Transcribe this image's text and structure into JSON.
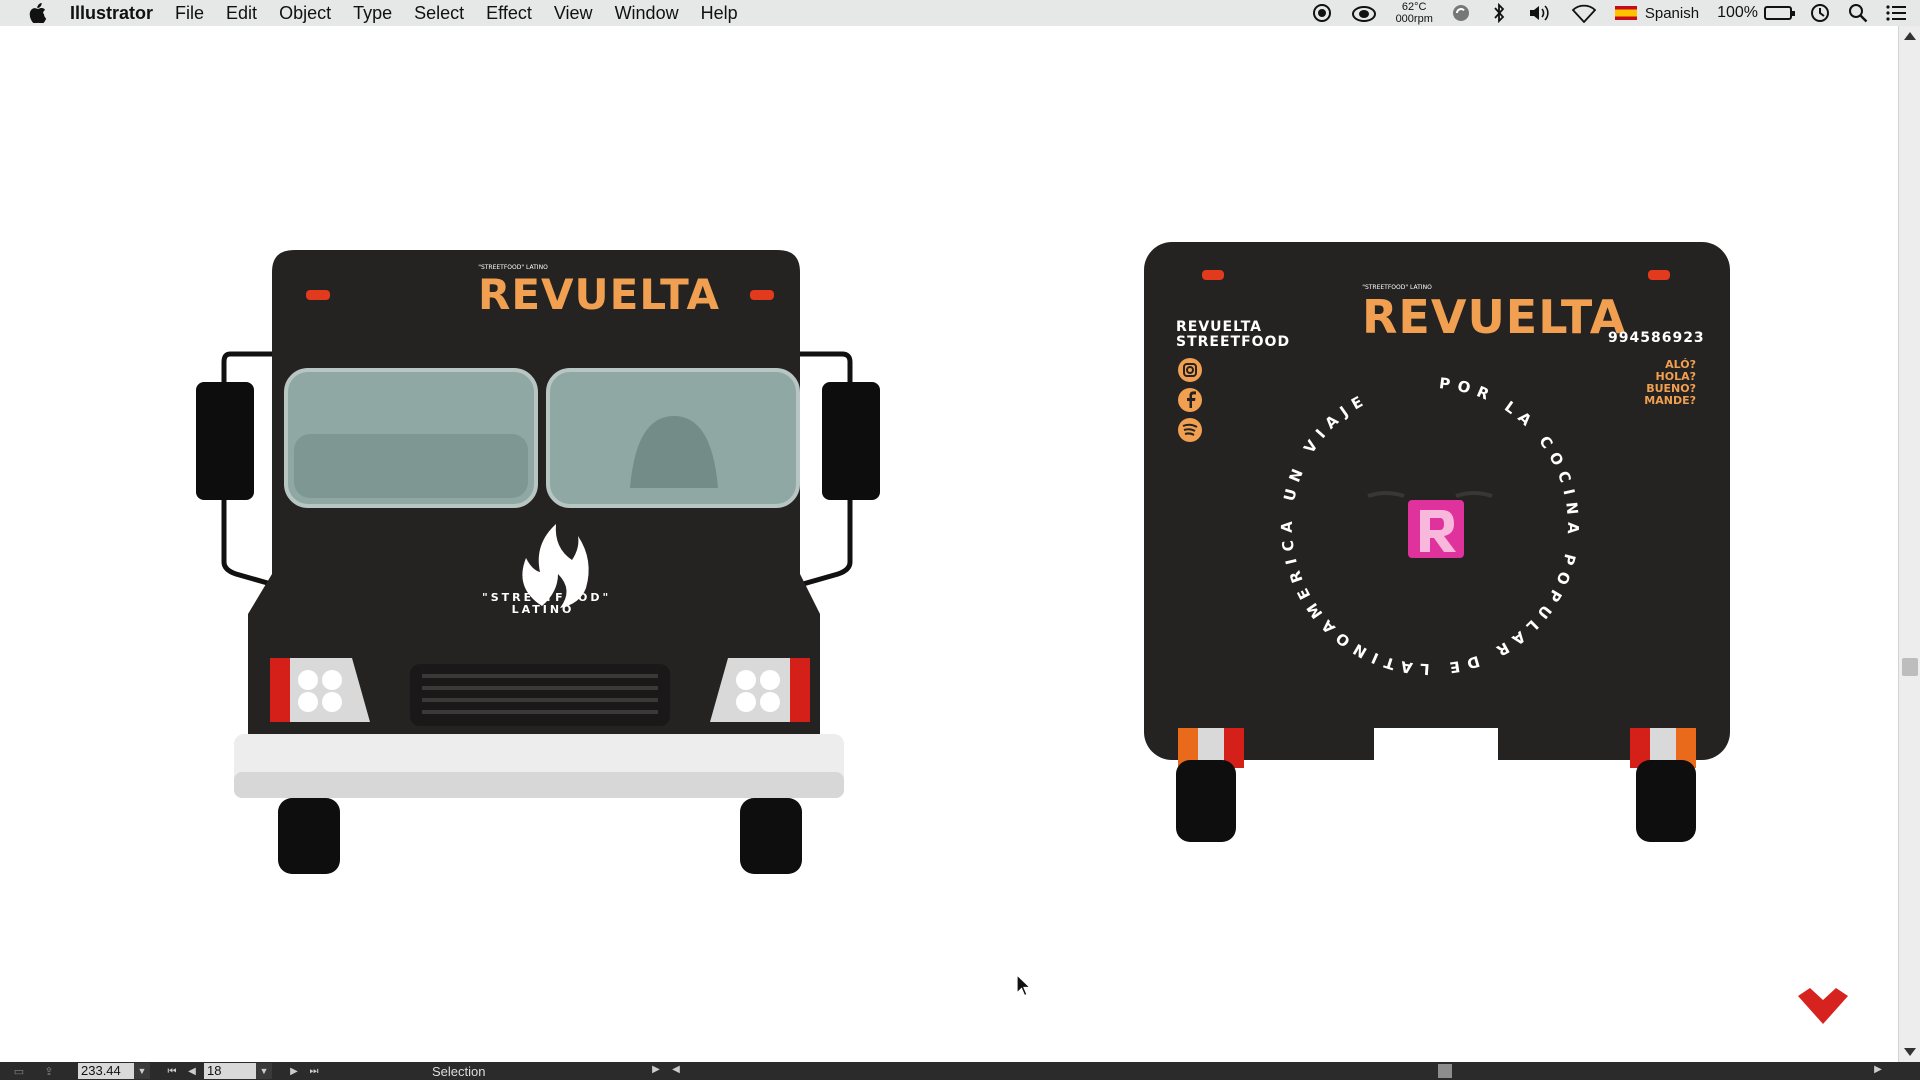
{
  "menubar": {
    "app_name": "Illustrator",
    "menus": [
      "File",
      "Edit",
      "Object",
      "Type",
      "Select",
      "Effect",
      "View",
      "Window",
      "Help"
    ],
    "temperature": "62°C",
    "fan_speed": "000rpm",
    "input_language": "Spanish",
    "battery_percent": "100%"
  },
  "statusbar": {
    "zoom": "233.44",
    "page": "18",
    "current_tool": "Selection"
  },
  "artwork": {
    "front": {
      "tagline_small": "\"STREETFOOD\" LATINO",
      "brand": "REVUELTA",
      "center_tagline_1": "\"STREETFOOD\"",
      "center_tagline_2": "LATINO"
    },
    "rear": {
      "tagline_small": "\"STREETFOOD\" LATINO",
      "brand": "REVUELTA",
      "name_line_1": "REVUELTA",
      "name_line_2": "STREETFOOD",
      "phone": "994586923",
      "greetings": [
        "ALÓ?",
        "HOLA?",
        "BUENO?",
        "MANDE?"
      ],
      "circle_text": "POR LA COCINA POPULAR DE LATINOAMERICA UN VIAJE",
      "center_letter": "R"
    }
  },
  "colors": {
    "truck_body": "#252222",
    "accent_orange": "#f0a050",
    "pink": "#e0329c",
    "brand_red": "#d7231f"
  }
}
